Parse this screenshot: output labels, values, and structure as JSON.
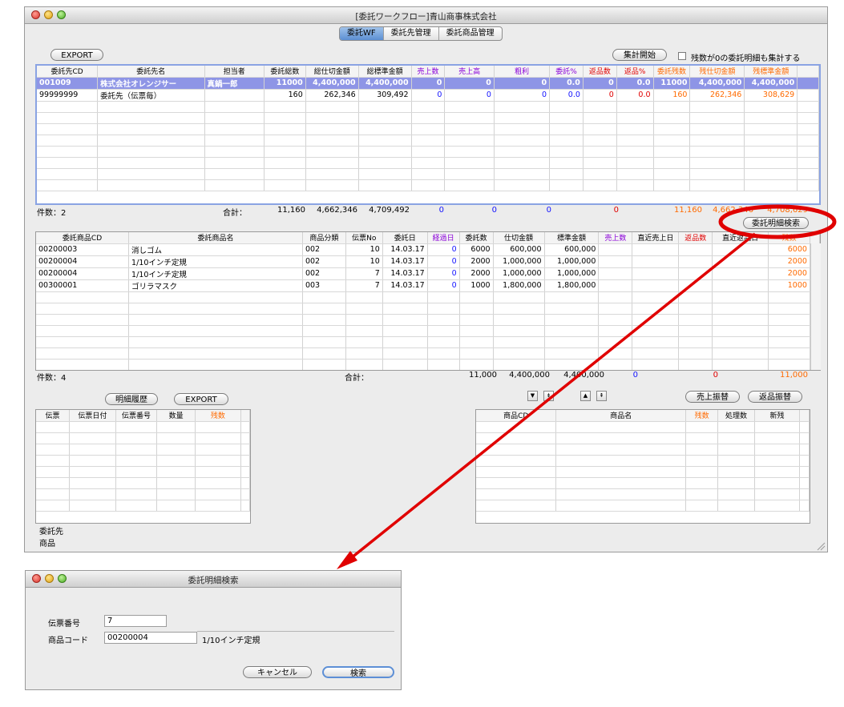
{
  "main_window": {
    "title": "[委託ワークフロー]青山商事株式会社",
    "tabs": [
      {
        "label": "委託WF",
        "active": true
      },
      {
        "label": "委託先管理",
        "active": false
      },
      {
        "label": "委託商品管理",
        "active": false
      }
    ],
    "export_button": "EXPORT",
    "aggregate_button": "集計開始",
    "zero_checkbox_label": "残数が0の委託明細も集計する",
    "upper_table": {
      "headers": [
        "委託先CD",
        "委託先名",
        "担当者",
        "委託総数",
        "総仕切金額",
        "総標準金額",
        "売上数",
        "売上高",
        "粗利",
        "委託%",
        "返品数",
        "返品%",
        "委託残数",
        "残仕切金額",
        "残標準金額"
      ],
      "rows": [
        [
          "001009",
          "株式会社オレンジサー",
          "真鍋一郎",
          "11000",
          "4,400,000",
          "4,400,000",
          "0",
          "0",
          "0",
          "0.0",
          "0",
          "0.0",
          "11000",
          "4,400,000",
          "4,400,000"
        ],
        [
          "99999999",
          "委託先（伝票毎）",
          "",
          "160",
          "262,346",
          "309,492",
          "0",
          "0",
          "0",
          "0.0",
          "0",
          "0.0",
          "160",
          "262,346",
          "308,629"
        ]
      ],
      "count_label": "件数：2",
      "total_label": "合計：",
      "totals": [
        "11,160",
        "4,662,346",
        "4,709,492",
        "0",
        "0",
        "0",
        "0",
        "11,160",
        "4,662,346",
        "4,708,629"
      ]
    },
    "search_button": "委託明細検索",
    "lower_table": {
      "headers": [
        "委託商品CD",
        "委託商品名",
        "商品分類",
        "伝票No",
        "委託日",
        "経過日",
        "委託数",
        "仕切金額",
        "標準金額",
        "売上数",
        "直近売上日",
        "返品数",
        "直近返品日",
        "残数"
      ],
      "rows": [
        [
          "00200003",
          "消しゴム",
          "002",
          "10",
          "14.03.17",
          "0",
          "6000",
          "600,000",
          "600,000",
          "",
          "",
          "",
          "",
          "6000"
        ],
        [
          "00200004",
          "1/10インチ定規",
          "002",
          "10",
          "14.03.17",
          "0",
          "2000",
          "1,000,000",
          "1,000,000",
          "",
          "",
          "",
          "",
          "2000"
        ],
        [
          "00200004",
          "1/10インチ定規",
          "002",
          "7",
          "14.03.17",
          "0",
          "2000",
          "1,000,000",
          "1,000,000",
          "",
          "",
          "",
          "",
          "2000"
        ],
        [
          "00300001",
          "ゴリラマスク",
          "003",
          "7",
          "14.03.17",
          "0",
          "1000",
          "1,800,000",
          "1,800,000",
          "",
          "",
          "",
          "",
          "1000"
        ]
      ],
      "count_label": "件数：4",
      "total_label": "合計：",
      "totals": [
        "11,000",
        "4,400,000",
        "4,400,000",
        "0",
        "0",
        "11,000"
      ]
    },
    "history_button": "明細履歴",
    "export_button_2": "EXPORT",
    "sales_transfer_button": "売上振替",
    "return_transfer_button": "返品振替",
    "history_table": {
      "headers": [
        "伝票",
        "伝票日付",
        "伝票番号",
        "数量",
        "残数"
      ]
    },
    "transfer_table": {
      "headers": [
        "商品CD",
        "商品名",
        "残数",
        "処理数",
        "新残"
      ]
    },
    "footer_labels": {
      "consignee": "委託先",
      "product": "商品"
    }
  },
  "dialog": {
    "title": "委託明細検索",
    "slip_no_label": "伝票番号",
    "slip_no_value": "7",
    "product_code_label": "商品コード",
    "product_code_value": "00200004",
    "product_name_value": "1/10インチ定規",
    "cancel_button": "キャンセル",
    "search_button": "検索"
  },
  "colors": {
    "highlight_red": "#e00000",
    "selected_row": "#8e95e6",
    "tab_active": "#5c8fd3"
  }
}
